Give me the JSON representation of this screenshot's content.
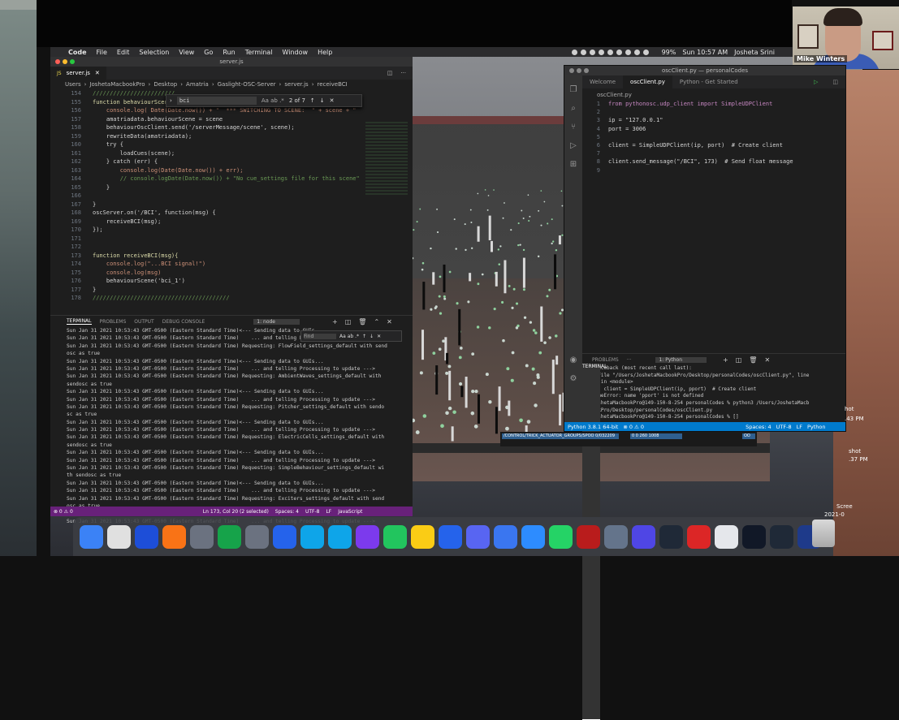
{
  "menubar": {
    "items": [
      "Code",
      "File",
      "Edit",
      "Selection",
      "View",
      "Go",
      "Run",
      "Terminal",
      "Window",
      "Help"
    ],
    "battery": "99%",
    "clock": "Sun 10:57 AM",
    "user": "Josheta Srini"
  },
  "webcam": {
    "name": "Mike Winters"
  },
  "left_editor": {
    "window_title": "server.js",
    "tab_label": "server.js",
    "breadcrumb": [
      "Users",
      "JoshetaMacbookPro",
      "Desktop",
      "Amatria",
      "Gaslight-OSC-Server",
      "server.js",
      "receiveBCI"
    ],
    "find_query": "bci",
    "find_count": "2 of 7",
    "line_numbers": [
      "154",
      "155",
      "156",
      "157",
      "158",
      "159",
      "160",
      "161",
      "162",
      "163",
      "164",
      "165",
      "166",
      "167",
      "168",
      "169",
      "170",
      "171",
      "172",
      "173",
      "174",
      "175",
      "176",
      "177",
      "178"
    ],
    "code_lines": [
      "////////////////////////",
      "function behaviourScene(scene){",
      "    console.log( Date(Date.now()) + \"  *** SWITCHING TO SCENE:  \" + scene + \" [\" + ",
      "    amatriadata.behaviourScene = scene",
      "    behaviourOscClient.send('/serverMessage/scene', scene);",
      "    rewriteData(amatriadata);",
      "    try {",
      "        loadCues(scene);",
      "    } catch (err) {",
      "        console.log(Date(Date.now()) + err);",
      "        // console.logDate(Date.now()) + \"No cue_settings file for this scene\");",
      "    }",
      "",
      "}",
      "oscServer.on('/BCI', function(msg) {",
      "    receiveBCI(msg);",
      "});",
      "",
      "",
      "function receiveBCI(msg){",
      "    console.log(\"...BCI signal!\")",
      "    console.log(msg)",
      "    behaviourScene('bci_1')",
      "}",
      "////////////////////////////////////////"
    ],
    "panel_tabs": [
      "TERMINAL",
      "PROBLEMS",
      "OUTPUT",
      "DEBUG CONSOLE"
    ],
    "terminal_select": "1: node",
    "terminal_find": "Find",
    "terminal_lines": [
      "Sun Jan 31 2021 10:53:43 GMT-0500 (Eastern Standard Time)<--- Sending data to GUIs...",
      "Sun Jan 31 2021 10:53:43 GMT-0500 (Eastern Standard Time)    ... and telling Processing to update --->",
      "Sun Jan 31 2021 10:53:43 GMT-0500 (Eastern Standard Time) Requesting: FlowField_settings_default with send",
      "osc as true",
      "Sun Jan 31 2021 10:53:43 GMT-0500 (Eastern Standard Time)<--- Sending data to GUIs...",
      "Sun Jan 31 2021 10:53:43 GMT-0500 (Eastern Standard Time)    ... and telling Processing to update --->",
      "Sun Jan 31 2021 10:53:43 GMT-0500 (Eastern Standard Time) Requesting: AmbientWaves_settings_default with",
      "sendosc as true",
      "Sun Jan 31 2021 10:53:43 GMT-0500 (Eastern Standard Time)<--- Sending data to GUIs...",
      "Sun Jan 31 2021 10:53:43 GMT-0500 (Eastern Standard Time)    ... and telling Processing to update --->",
      "Sun Jan 31 2021 10:53:43 GMT-0500 (Eastern Standard Time) Requesting: Pitcher_settings_default with sendo",
      "sc as true",
      "Sun Jan 31 2021 10:53:43 GMT-0500 (Eastern Standard Time)<--- Sending data to GUIs...",
      "Sun Jan 31 2021 10:53:43 GMT-0500 (Eastern Standard Time)    ... and telling Processing to update --->",
      "Sun Jan 31 2021 10:53:43 GMT-0500 (Eastern Standard Time) Requesting: ElectricCells_settings_default with",
      "sendosc as true",
      "Sun Jan 31 2021 10:53:43 GMT-0500 (Eastern Standard Time)<--- Sending data to GUIs...",
      "Sun Jan 31 2021 10:53:43 GMT-0500 (Eastern Standard Time)    ... and telling Processing to update --->",
      "Sun Jan 31 2021 10:53:43 GMT-0500 (Eastern Standard Time) Requesting: SimpleBehaviour_settings_default wi",
      "th sendosc as true",
      "Sun Jan 31 2021 10:53:43 GMT-0500 (Eastern Standard Time)<--- Sending data to GUIs...",
      "Sun Jan 31 2021 10:53:43 GMT-0500 (Eastern Standard Time)    ... and telling Processing to update --->",
      "Sun Jan 31 2021 10:53:43 GMT-0500 (Eastern Standard Time) Requesting: Exciters_settings_default with send",
      "osc as true",
      "Sun Jan 31 2021 10:53:43 GMT-0500 (Eastern Standard Time)<--- Sending data to GUIs...",
      "Sun Jan 31 2021 10:53:43 GMT-0500 (Eastern Standard Time)    ... and telling Processing to update --->"
    ],
    "status": {
      "errors": "⊗ 0 ⚠ 0",
      "position": "Ln 173, Col 20 (2 selected)",
      "spaces": "Spaces: 4",
      "encoding": "UTF-8",
      "eol": "LF",
      "language": "JavaScript"
    }
  },
  "right_editor": {
    "window_title": "oscClient.py — personalCodes",
    "tabs": [
      "Welcome",
      "oscClient.py",
      "Python - Get Started"
    ],
    "breadcrumb": "oscClient.py",
    "line_numbers": [
      "1",
      "2",
      "3",
      "4",
      "5",
      "6",
      "7",
      "8",
      "9"
    ],
    "code_lines": [
      "from pythonosc.udp_client import SimpleUDPClient",
      "",
      "ip = \"127.0.0.1\"",
      "port = 3006",
      "",
      "client = SimpleUDPClient(ip, port)  # Create client",
      "",
      "client.send_message(\"/BCI\", 173)  # Send float message",
      ""
    ],
    "panel_tabs": [
      "TERMINAL",
      "PROBLEMS",
      "···"
    ],
    "terminal_select": "1: Python",
    "terminal_lines": [
      "Traceback (most recent call last):",
      "  File \"/Users/JoshetaMacbookPro/Desktop/personalCodes/oscClient.py\", line",
      "5, in <module>",
      "    client = SimpleUDPClient(ip, pport)  # Create client",
      "NameError: name 'pport' is not defined",
      "JoshetaMacbookPro@149-150-8-254 personalCodes % python3 /Users/JoshetaMacb",
      "ookPro/Desktop/personalCodes/oscClient.py",
      "JoshetaMacbookPro@149-150-8-254 personalCodes % []"
    ],
    "status": {
      "python": "Python 3.8.1 64-bit",
      "errors": "⊗ 0 ⚠ 0",
      "spaces": "Spaces: 4",
      "encoding": "UTF-8",
      "eol": "LF",
      "language": "Python"
    }
  },
  "processing_strip": {
    "a": "/CONTROL/TRICK_ACTUATOR_GROUPS/SPOO 0/032209",
    "b": "0 0 260 1008",
    "c": "OO"
  },
  "desktop_labels": [
    "Scree",
    "2021-0",
    "hot",
    ".43 PM",
    "shot",
    ".37 PM"
  ],
  "dock": {
    "icons": [
      "finder-icon",
      "preview-icon",
      "chrome-icon",
      "firefox-icon",
      "launchpad-icon",
      "excel-icon",
      "settings-icon",
      "vscode-icon",
      "arduino-icon",
      "skype-icon",
      "slack-icon",
      "spotify-icon",
      "notes-icon",
      "word-icon",
      "discord-icon",
      "signal-icon",
      "zoom-icon",
      "whatsapp-icon",
      "illustrator-icon",
      "image-capture-icon",
      "teams-icon",
      "terminal-icon",
      "acrobat-icon",
      "pd-icon",
      "processing-icon",
      "quicktime-icon",
      "shield-icon"
    ]
  }
}
